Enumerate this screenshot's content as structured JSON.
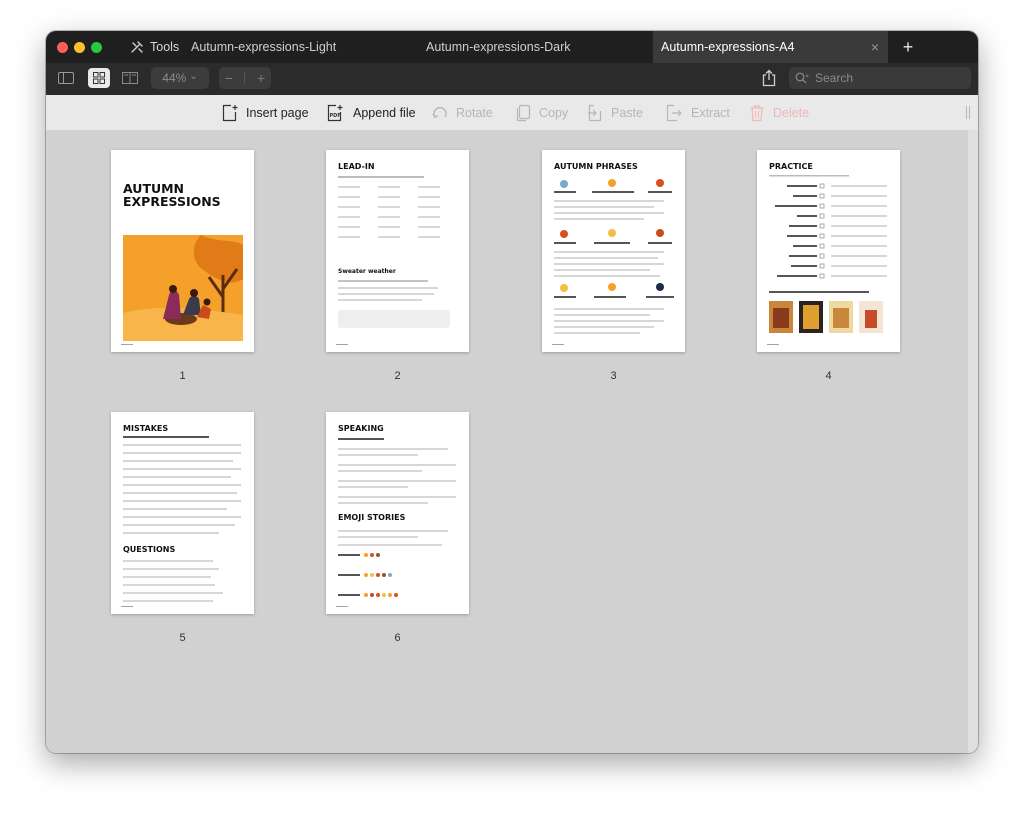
{
  "titlebar": {
    "tools_label": "Tools",
    "tabs": [
      {
        "label": "Autumn-expressions-Light"
      },
      {
        "label": "Autumn-expressions-Dark"
      },
      {
        "label": "Autumn-expressions-A4"
      }
    ],
    "close_tab_glyph": "×",
    "new_tab_glyph": "+"
  },
  "toolbar": {
    "zoom_value": "44%",
    "zoom_chevron": "⌄",
    "stepper_minus": "−",
    "stepper_plus": "+",
    "search_placeholder": "Search"
  },
  "actions": {
    "insert_page": "Insert page",
    "append_file": "Append file",
    "rotate": "Rotate",
    "copy": "Copy",
    "paste": "Paste",
    "extract": "Extract",
    "delete": "Delete"
  },
  "pages": [
    {
      "number": "1",
      "title": "AUTUMN EXPRESSIONS"
    },
    {
      "number": "2",
      "title": "LEAD-IN",
      "subtitle": "Sweater weather"
    },
    {
      "number": "3",
      "title": "AUTUMN PHRASES"
    },
    {
      "number": "4",
      "title": "PRACTICE"
    },
    {
      "number": "5",
      "title": "MISTAKES",
      "subtitle": "QUESTIONS"
    },
    {
      "number": "6",
      "title": "SPEAKING",
      "subtitle": "EMOJI STORIES"
    }
  ],
  "colors": {
    "accent_orange": "#f4a02a",
    "delete_red": "#efb7b7"
  }
}
